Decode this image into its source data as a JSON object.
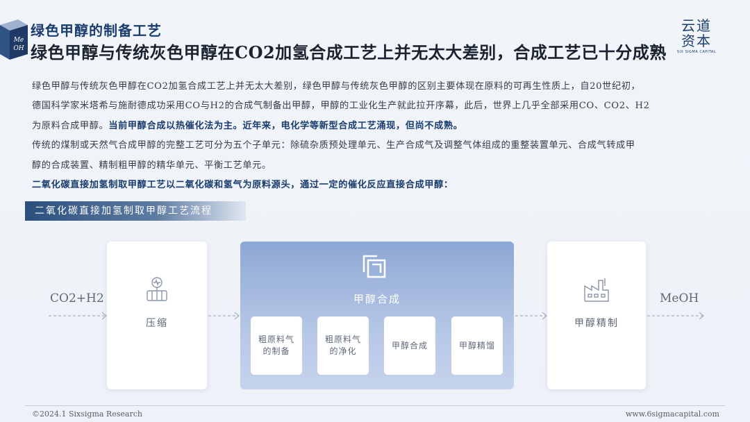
{
  "logo": {
    "text": "Me OH"
  },
  "header": {
    "subtitle": "绿色甲醇的制备工艺",
    "title": "绿色甲醇与传统灰色甲醇在CO2加氢合成工艺上并无太大差别，合成工艺已十分成熟"
  },
  "brand": {
    "cn_line1": "云道",
    "cn_line2": "资本",
    "en": "SIX SIGMA CAPITAL"
  },
  "body": {
    "p1": "绿色甲醇与传统灰色甲醇在CO2加氢合成工艺上并无太大差别，绿色甲醇与传统灰色甲醇的区别主要体现在原料的可再生性质上，自20世纪初，",
    "p2": "德国科学家米塔希与施耐德成功采用CO与H2的合成气制备出甲醇，甲醇的工业化生产就此拉开序幕，此后，世界上几乎全部采用CO、CO2、H2",
    "p3a": "为原料合成甲醇。",
    "p3b": "当前甲醇合成以热催化法为主。近年来，电化学等新型合成工艺涌现，但尚不成熟。",
    "p4": "传统的煤制或天然气合成甲醇的完整工艺可分为五个子单元：除硫杂质预处理单元、生产合成气及调整气体组成的重整装置单元、合成气转成甲",
    "p5": "醇的合成装置、精制粗甲醇的精华单元、平衡工艺单元。",
    "p6": "二氧化碳直接加氢制取甲醇工艺以二氧化碳和氢气为原料源头，通过一定的催化反应直接合成甲醇："
  },
  "section": {
    "label": "二氧化碳直接加氢制取甲醇工艺流程"
  },
  "flow": {
    "input": "CO2+H2",
    "step1": "压缩",
    "synthesis_title": "甲醇合成",
    "sub_steps": [
      "粗原料气的制备",
      "粗原料气的净化",
      "甲醇合成",
      "甲醇精馏"
    ],
    "step3": "甲醇精制",
    "output": "MeOH"
  },
  "footer": {
    "left": "©2024.1 Sixsigma Research",
    "right": "www.6sigmacapital.com"
  },
  "colors": {
    "accent": "#1a3d6e",
    "flow_box": "#8da7d4",
    "text": "#333c48"
  }
}
